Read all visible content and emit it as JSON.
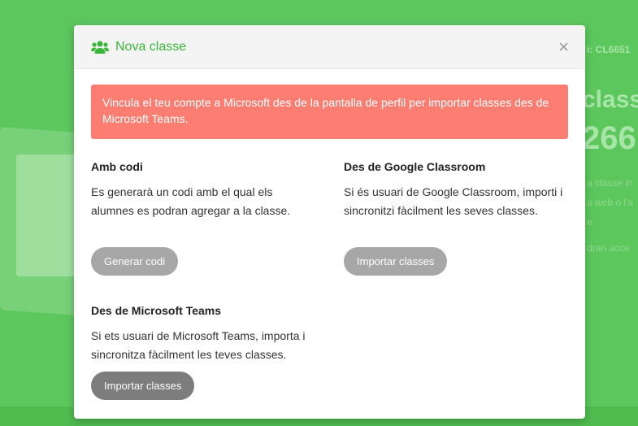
{
  "background": {
    "code_fragment": "i: CL6651",
    "big_text_1": "classe",
    "big_text_2": "266",
    "small_line_1": "a classe in",
    "small_line_2": "a web o l'a",
    "small_line_3": "e",
    "small_line_4": "dran acce"
  },
  "modal": {
    "title": "Nova classe",
    "header_icon": "users-icon",
    "close_symbol": "×",
    "alert_text": "Vincula el teu compte a Microsoft des de la pantalla de perfil per importar classes des de Microsoft Teams.",
    "sections": {
      "code": {
        "heading": "Amb codi",
        "description": "Es generarà un codi amb el qual els alumnes es podran agregar a la classe.",
        "button_label": "Generar codi"
      },
      "google": {
        "heading": "Des de Google Classroom",
        "description": "Si és usuari de Google Classroom, importi i sincronitzi fàcilment les seves classes.",
        "button_label": "Importar classes"
      },
      "teams": {
        "heading": "Des de Microsoft Teams",
        "description": "Si ets usuari de Microsoft Teams, importa i sincronitza fàcilment les teves classes.",
        "button_label": "Importar classes"
      }
    }
  },
  "colors": {
    "background_green": "#5cc75c",
    "title_green": "#3bb53b",
    "alert_red": "#fc7e72",
    "button_gray": "#a7a7a7",
    "button_dark_gray": "#7d7d7d"
  }
}
